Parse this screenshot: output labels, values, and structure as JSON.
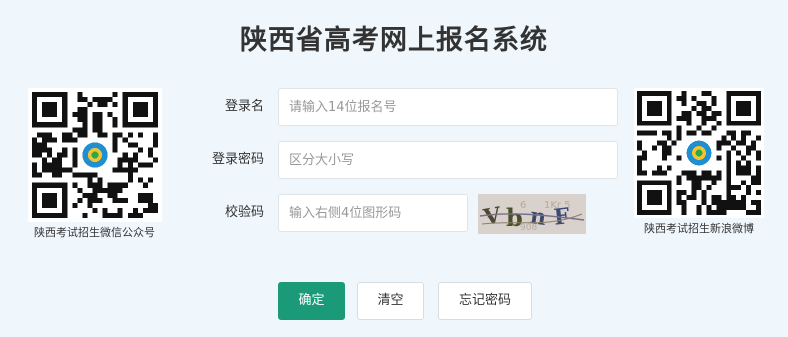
{
  "page": {
    "title": "陕西省高考网上报名系统"
  },
  "qr_left": {
    "caption": "陕西考试招生微信公众号"
  },
  "qr_right": {
    "caption": "陕西考试招生新浪微博"
  },
  "form": {
    "username": {
      "label": "登录名",
      "placeholder": "请输入14位报名号"
    },
    "password": {
      "label": "登录密码",
      "placeholder": "区分大小写"
    },
    "captcha": {
      "label": "校验码",
      "placeholder": "输入右侧4位图形码",
      "image_text": "VbnF"
    }
  },
  "buttons": {
    "confirm": "确定",
    "clear": "清空",
    "forgot": "忘记密码"
  },
  "colors": {
    "background": "#f0f7fc",
    "primary": "#1b9a7a",
    "qr_center": "#1f8fcf"
  }
}
